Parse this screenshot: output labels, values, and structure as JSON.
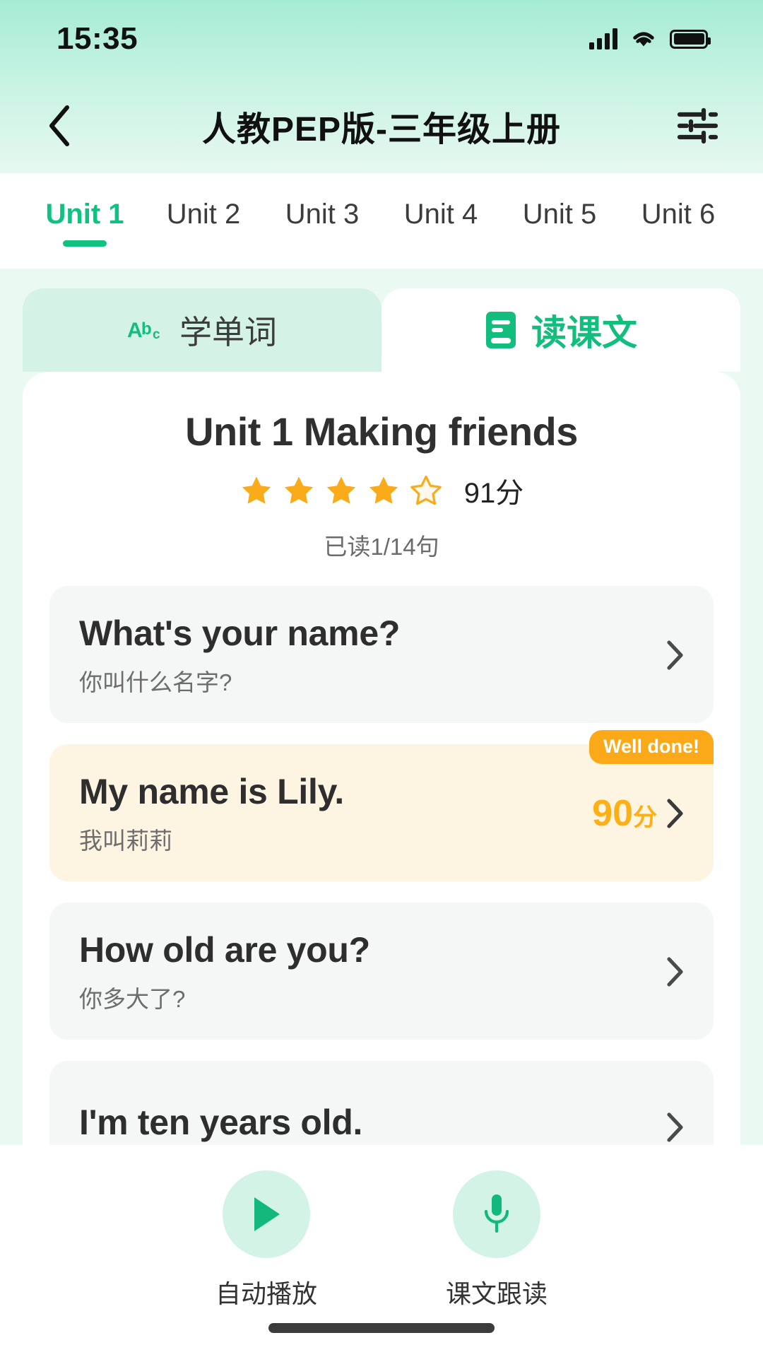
{
  "status_bar": {
    "time": "15:35",
    "signal_icon": "signal-bars-icon",
    "wifi_icon": "wifi-icon",
    "battery_icon": "battery-full-icon"
  },
  "nav": {
    "back_icon": "chevron-left-icon",
    "title": "人教PEP版-三年级上册",
    "filter_icon": "sliders-filter-icon"
  },
  "unit_tabs": {
    "active_index": 0,
    "items": [
      {
        "label": "Unit 1"
      },
      {
        "label": "Unit 2"
      },
      {
        "label": "Unit 3"
      },
      {
        "label": "Unit 4"
      },
      {
        "label": "Unit 5"
      },
      {
        "label": "Unit 6"
      }
    ]
  },
  "segmented_tabs": {
    "active_index": 1,
    "items": [
      {
        "label": "学单词",
        "icon": "abc-icon"
      },
      {
        "label": "读课文",
        "icon": "book-icon"
      }
    ]
  },
  "lesson": {
    "title": "Unit 1 Making friends",
    "stars_filled": 4,
    "stars_total": 5,
    "score": "91分",
    "progress": "已读1/14句"
  },
  "sentences": [
    {
      "en": "What's your name?",
      "zh": "你叫什么名字?",
      "score": null,
      "badge": null,
      "highlight": false
    },
    {
      "en": "My name is Lily.",
      "zh": "我叫莉莉",
      "score": "90",
      "score_unit": "分",
      "badge": "Well done!",
      "highlight": true
    },
    {
      "en": "How old are you?",
      "zh": "你多大了?",
      "score": null,
      "badge": null,
      "highlight": false
    },
    {
      "en": "I'm ten years old.",
      "zh": "",
      "score": null,
      "badge": null,
      "highlight": false
    }
  ],
  "bottom_bar": {
    "items": [
      {
        "label": "自动播放",
        "icon": "play-icon"
      },
      {
        "label": "课文跟读",
        "icon": "microphone-icon"
      }
    ]
  },
  "colors": {
    "accent_green": "#0FC280",
    "accent_orange": "#FBA919",
    "star_gold": "#FAAB1A",
    "page_bg": "#EAF9F2",
    "card_bg": "#F5F6F6",
    "highlight_bg": "#FEF4E2"
  }
}
